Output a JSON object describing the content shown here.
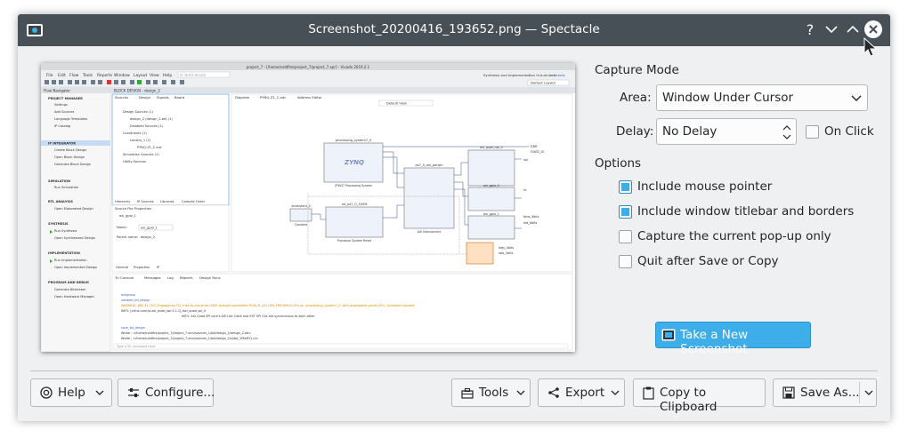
{
  "window": {
    "title": "Screenshot_20200416_193652.png — Spectacle",
    "app_icon": "spectacle-icon",
    "titlebar_buttons": [
      "help-icon",
      "minimize-icon",
      "maximize-icon",
      "close-icon"
    ]
  },
  "capture_mode": {
    "heading": "Capture Mode",
    "area_label": "Area:",
    "area_value": "Window Under Cursor",
    "delay_label": "Delay:",
    "delay_value": "No Delay",
    "on_click_label": "On Click",
    "on_click_checked": false
  },
  "options": {
    "heading": "Options",
    "items": [
      {
        "label": "Include mouse pointer",
        "checked": true
      },
      {
        "label": "Include window titlebar and borders",
        "checked": true
      },
      {
        "label": "Capture the current pop-up only",
        "checked": false
      },
      {
        "label": "Quit after Save or Copy",
        "checked": false
      }
    ]
  },
  "take_screenshot_label": "Take a New Screenshot",
  "bottom_bar": {
    "help": "Help",
    "configure": "Configure...",
    "tools": "Tools",
    "export": "Export",
    "copy": "Copy to Clipboard",
    "save_as": "Save As..."
  },
  "preview": {
    "title": "project_7 - [/home/coldfire/project_7/project_7.xpr] - Vivado 2019.2.1",
    "menu": [
      "File",
      "Edit",
      "Flow",
      "Tools",
      "Reports",
      "Window",
      "Layout",
      "View",
      "Help"
    ],
    "quick_access": "Q- Quick Access",
    "status_right": "Synthesis and Implementation Out-of-date",
    "details": "details",
    "layout": "Default Layout",
    "flow_navigator": {
      "title": "Flow Navigator",
      "groups": [
        {
          "name": "PROJECT MANAGER",
          "items": [
            "Settings",
            "Add Sources",
            "Language Templates",
            "IP Catalog"
          ]
        },
        {
          "name": "IP INTEGRATOR",
          "items": [
            "Create Block Design",
            "Open Block Design",
            "Generate Block Design"
          ]
        },
        {
          "name": "SIMULATION",
          "items": [
            "Run Simulation"
          ]
        },
        {
          "name": "RTL ANALYSIS",
          "items": [
            "Open Elaborated Design"
          ]
        },
        {
          "name": "SYNTHESIS",
          "items": [
            "Run Synthesis",
            "Open Synthesized Design"
          ]
        },
        {
          "name": "IMPLEMENTATION",
          "items": [
            "Run Implementation",
            "Open Implemented Design"
          ]
        },
        {
          "name": "PROGRAM AND DEBUG",
          "items": [
            "Generate Bitstream",
            "Open Hardware Manager"
          ]
        }
      ]
    },
    "block_design_header": "BLOCK DESIGN - design_2",
    "sources_tabs": [
      "Sources",
      "Design",
      "Signals",
      "Board"
    ],
    "sources_tree": [
      "Design Sources (1)",
      "design_2 (design_2.bd) (1)",
      "Disabled Sources (1)",
      "Constraints (1)",
      "constrs_1 (1)",
      "PYNQ-Z1_C.xdc",
      "Simulation Sources (1)",
      "Utility Sources"
    ],
    "sources_bottom_tabs": [
      "Hierarchy",
      "IP Sources",
      "Libraries",
      "Compile Order"
    ],
    "props_title": "Source File Properties",
    "props_item": "axi_gpio_1",
    "props_name_label": "Name:",
    "props_name_value": "axi_gpio_1",
    "props_parent_label": "Parent name:",
    "props_parent_value": "design_2",
    "props_tabs": [
      "General",
      "Properties",
      "IP"
    ],
    "diagram_tabs": [
      "Diagram",
      "PYNQ-Z1_C.xdc",
      "Address Editor"
    ],
    "diagram_view": "Default View",
    "diagram_blocks": {
      "zynq": "processing_system7_0",
      "zynq_logo": "ZYNQ",
      "zynq_sub": "ZYNQ7 Processing System",
      "interconnect": "ps7_0_axi_periph",
      "interconnect_sub": "AXI Interconnect",
      "reset": "rst_ps7_0_100M",
      "reset_sub": "Processor System Reset",
      "const": "xlconstant_0",
      "const_sub": "Constant",
      "gpio0": "axi_quad_spi_0",
      "gpio1": "axi_gpio_0",
      "gpio2": "axi_gpio_1",
      "ports": [
        "DDR",
        "FIXED_IO",
        "spi",
        "iic",
        "btns_4bits",
        "led_4bits",
        "leds_4bits",
        "sws_2bits"
      ]
    },
    "console_tabs": [
      "Tcl Console",
      "Messages",
      "Log",
      "Reports",
      "Design Runs"
    ],
    "console_lines": [
      "endgroup",
      "validate_bd_design",
      "WARNING: [BD 41-702] Propagation TCL tries to overwrite USER strength parameter PCW_M_AXI_GP0_FREQMHZ(100) on '/processing_system7_0' with propagated value(100). Command ignored",
      "INFO: [xilinx.com:ip:axi_quad_spi:3.2-1] /axi_quad_spi_0",
      "INFO: AXI Quad SPI core's AXI Lite Clock and EXT SPI CLK are synchronous to each other",
      "save_bd_design",
      "Wrote  : </home/coldfire/project_7/project_7.srcs/sources_1/bd/design_2/design_2.bd>",
      "Wrote  : </home/coldfire/project_7/project_7.srcs/sources_1/bd/design_2/ui/bd_1f5bff11.ui>"
    ],
    "console_input": "Type a Tcl command here"
  }
}
